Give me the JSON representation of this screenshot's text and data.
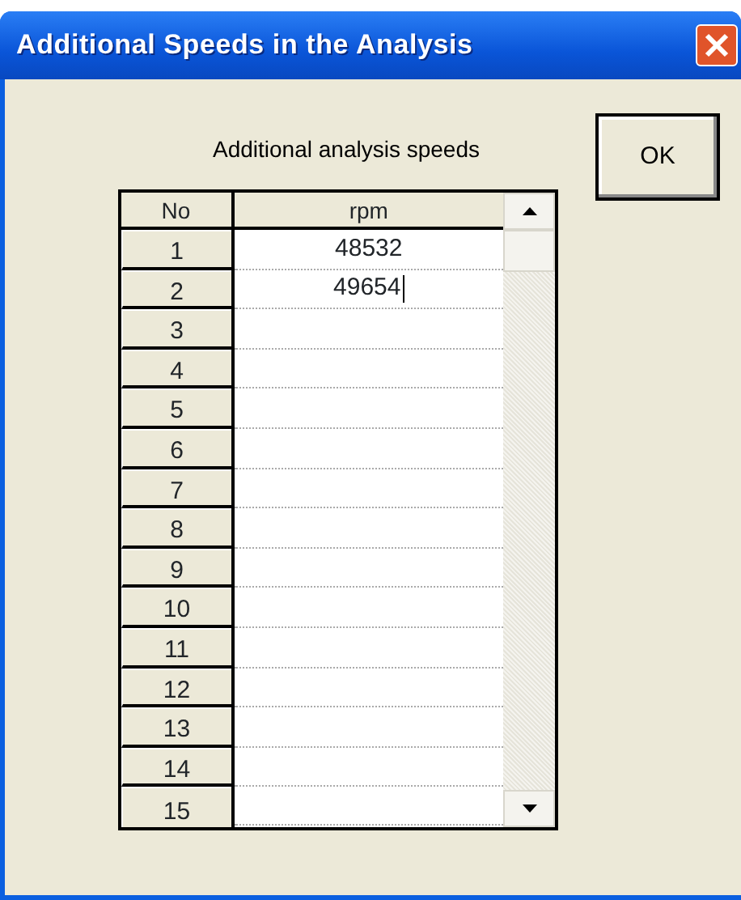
{
  "window": {
    "title": "Additional Speeds in the Analysis"
  },
  "label": "Additional analysis speeds",
  "ok_button": "OK",
  "table": {
    "columns": [
      "No",
      "rpm"
    ],
    "rows": [
      {
        "no": "1",
        "rpm": "48532",
        "editing": false
      },
      {
        "no": "2",
        "rpm": "49654",
        "editing": true
      },
      {
        "no": "3",
        "rpm": "",
        "editing": false
      },
      {
        "no": "4",
        "rpm": "",
        "editing": false
      },
      {
        "no": "5",
        "rpm": "",
        "editing": false
      },
      {
        "no": "6",
        "rpm": "",
        "editing": false
      },
      {
        "no": "7",
        "rpm": "",
        "editing": false
      },
      {
        "no": "8",
        "rpm": "",
        "editing": false
      },
      {
        "no": "9",
        "rpm": "",
        "editing": false
      },
      {
        "no": "10",
        "rpm": "",
        "editing": false
      },
      {
        "no": "11",
        "rpm": "",
        "editing": false
      },
      {
        "no": "12",
        "rpm": "",
        "editing": false
      },
      {
        "no": "13",
        "rpm": "",
        "editing": false
      },
      {
        "no": "14",
        "rpm": "",
        "editing": false
      },
      {
        "no": "15",
        "rpm": "",
        "editing": false
      }
    ]
  }
}
